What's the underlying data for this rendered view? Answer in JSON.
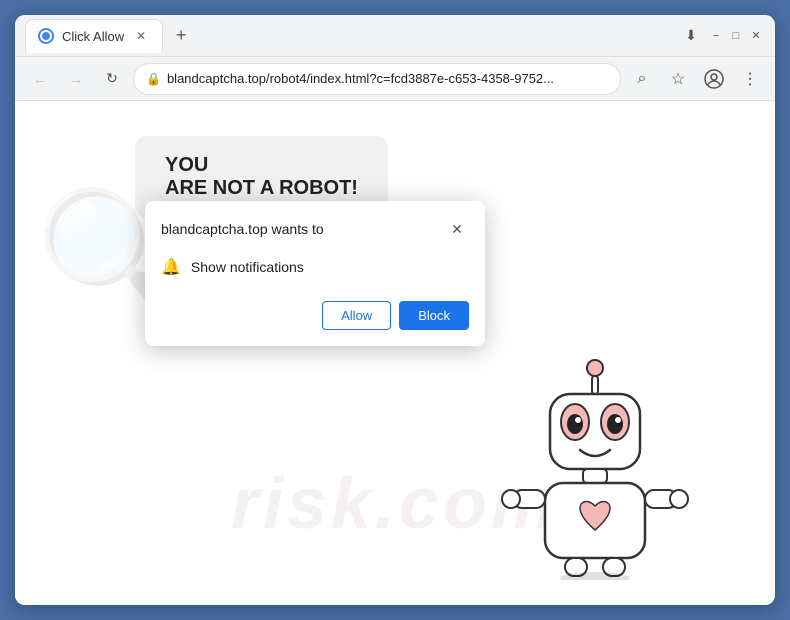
{
  "window": {
    "title": "Click Allow",
    "controls": {
      "minimize": "−",
      "maximize": "□",
      "close": "✕"
    }
  },
  "tabs": [
    {
      "title": "Click Allow",
      "active": true,
      "close": "✕"
    }
  ],
  "new_tab_label": "+",
  "toolbar": {
    "back": "←",
    "forward": "→",
    "refresh": "↻",
    "url": "blandcaptcha.top/robot4/index.html?c=fcd3887e-c653-4358-9752...",
    "url_domain": "blandcaptcha.top",
    "url_path": "/robot4/index.html?c=fcd3887e-c653-4358-9752...",
    "search_icon": "⌕",
    "bookmark_icon": "☆",
    "profile_icon": "👤",
    "menu_icon": "⋮",
    "lock_icon": "🔒",
    "download_icon": "⬇"
  },
  "page": {
    "speech_line1": "YOU",
    "speech_line2": "ARE NOT A ROBOT!",
    "watermark": "risk.com"
  },
  "popup": {
    "title": "blandcaptcha.top wants to",
    "permission_label": "Show notifications",
    "close_icon": "✕",
    "bell_icon": "🔔",
    "allow_label": "Allow",
    "block_label": "Block"
  },
  "colors": {
    "allow_blue": "#1a73e8",
    "block_blue": "#1a73e8",
    "browser_bg": "#f1f3f4",
    "border": "#5b8dd9"
  }
}
